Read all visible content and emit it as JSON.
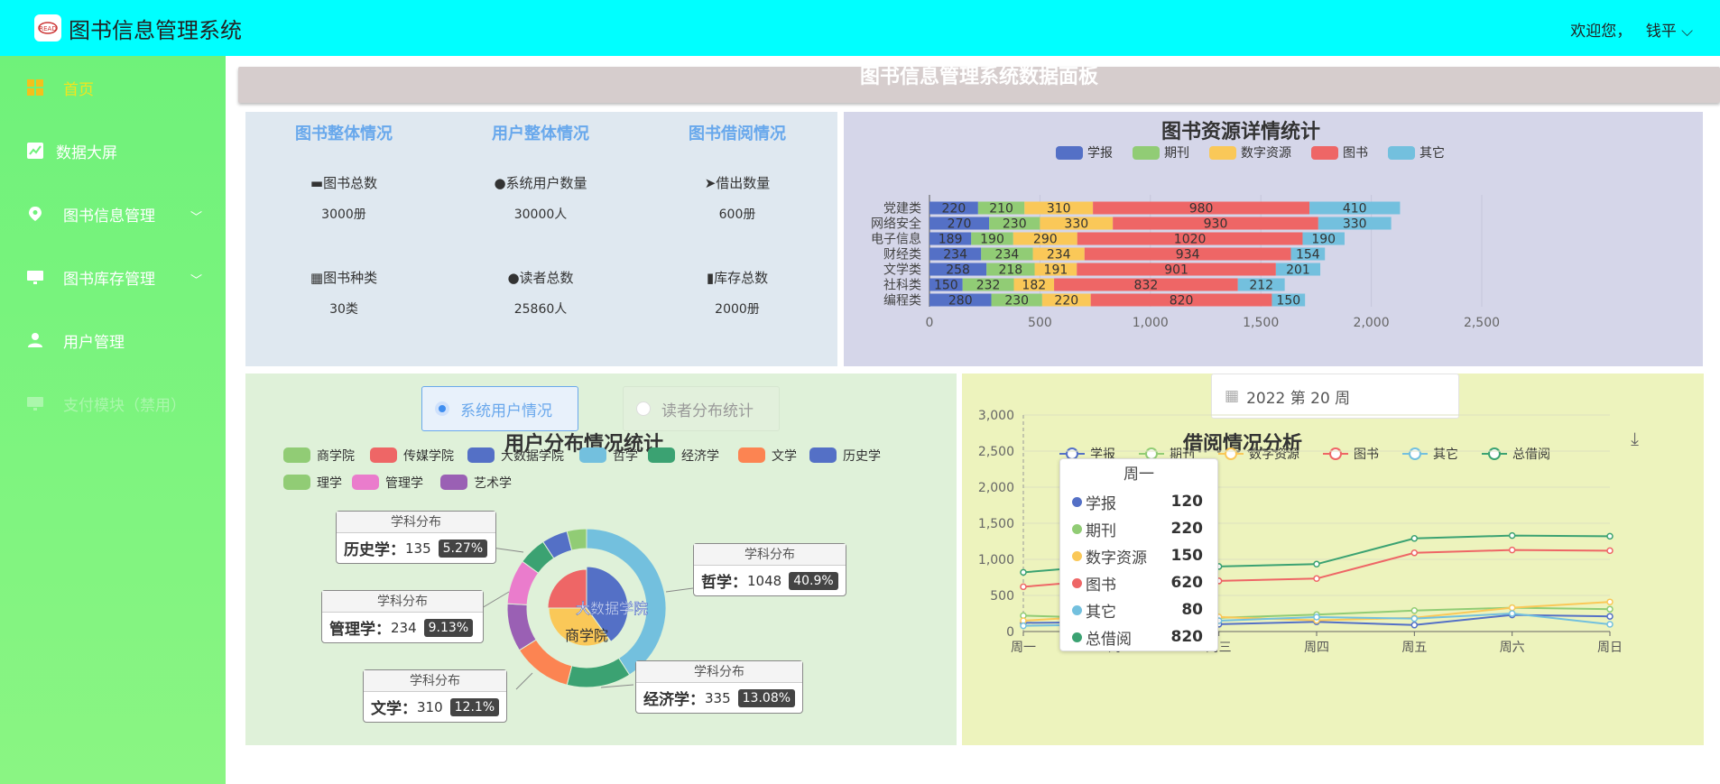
{
  "app": {
    "title": "图书信息管理系统",
    "greeting": "欢迎您，",
    "user": "钱平 ⌵"
  },
  "sidebar": {
    "items": [
      {
        "label": "首页",
        "icon": "grid-icon"
      },
      {
        "label": "数据大屏",
        "icon": "chart-icon"
      },
      {
        "label": "图书信息管理",
        "icon": "location-icon"
      },
      {
        "label": "图书库存管理",
        "icon": "monitor-icon"
      },
      {
        "label": "用户管理",
        "icon": "user-icon"
      },
      {
        "label": "支付模块（禁用）",
        "icon": "monitor-icon"
      }
    ]
  },
  "banner": {
    "title": "图书信息管理系统数据面板"
  },
  "overview": {
    "columns": [
      {
        "head": "图书整体情况",
        "items": [
          {
            "label": "图书总数",
            "icon": "book-icon",
            "value": "3000册"
          },
          {
            "label": "图书种类",
            "icon": "category-icon",
            "value": "30类"
          }
        ]
      },
      {
        "head": "用户整体情况",
        "items": [
          {
            "label": "系统用户数量",
            "icon": "user-icon",
            "value": "30000人"
          },
          {
            "label": "读者总数",
            "icon": "user-icon",
            "value": "25860人"
          }
        ]
      },
      {
        "head": "图书借阅情况",
        "items": [
          {
            "label": "借出数量",
            "icon": "send-icon",
            "value": "600册"
          },
          {
            "label": "库存总数",
            "icon": "bars-icon",
            "value": "2000册"
          }
        ]
      }
    ]
  },
  "tabs": {
    "users": "系统用户情况",
    "readers": "读者分布统计"
  },
  "date_picker": {
    "value": "2022 第 20 周"
  },
  "colors": {
    "blue": "#5470c6",
    "green": "#91cc75",
    "yellow": "#fac858",
    "red": "#ee6666",
    "cyan": "#73c0de",
    "teal": "#3ba272",
    "orange": "#fc8452",
    "purple": "#9a60b4",
    "pink": "#ea7ccc"
  },
  "chart_data": [
    {
      "type": "bar",
      "stacked": true,
      "orientation": "horizontal",
      "title": "图书资源详情统计",
      "categories": [
        "党建类",
        "网络安全",
        "电子信息",
        "财经类",
        "文学类",
        "社科类",
        "编程类"
      ],
      "series": [
        {
          "name": "学报",
          "values": [
            220,
            270,
            189,
            234,
            258,
            150,
            280
          ]
        },
        {
          "name": "期刊",
          "values": [
            210,
            230,
            190,
            234,
            218,
            232,
            230
          ]
        },
        {
          "name": "数字资源",
          "values": [
            310,
            330,
            290,
            234,
            191,
            182,
            220
          ]
        },
        {
          "name": "图书",
          "values": [
            980,
            930,
            1020,
            934,
            901,
            832,
            820
          ]
        },
        {
          "name": "其它",
          "values": [
            410,
            330,
            190,
            154,
            201,
            212,
            150
          ]
        }
      ],
      "xticks": [
        "0",
        "500",
        "1,000",
        "1,500",
        "2,000",
        "2,500"
      ],
      "xlim": [
        0,
        2500
      ],
      "legend": "top"
    },
    {
      "type": "pie",
      "title": "用户分布情况统计",
      "legend": [
        "商学院",
        "传媒学院",
        "大数据学院",
        "哲学",
        "经济学",
        "文学",
        "历史学",
        "理学",
        "管理学",
        "艺术学"
      ],
      "inner": [
        {
          "name": "大数据学院",
          "value": 40
        },
        {
          "name": "商学院",
          "value": 35
        },
        {
          "name": "传媒学院",
          "value": 25
        }
      ],
      "outer": [
        {
          "name": "哲学",
          "value": 1048,
          "pct": "40.9%"
        },
        {
          "name": "经济学",
          "value": 335,
          "pct": "13.08%"
        },
        {
          "name": "文学",
          "value": 310,
          "pct": "12.1%"
        },
        {
          "name": "艺术学",
          "value": 251
        },
        {
          "name": "管理学",
          "value": 234,
          "pct": "9.13%"
        },
        {
          "name": "理学",
          "value": 147
        },
        {
          "name": "历史学",
          "value": 135,
          "pct": "5.27%"
        },
        {
          "name": "商学院",
          "value": 102
        }
      ],
      "callout_head": "学科分布"
    },
    {
      "type": "line",
      "title": "借阅情况分析",
      "categories": [
        "周一",
        "周二",
        "周三",
        "周四",
        "周五",
        "周六",
        "周日"
      ],
      "series": [
        {
          "name": "学报",
          "values": [
            120,
            132,
            101,
            134,
            90,
            230,
            210
          ]
        },
        {
          "name": "期刊",
          "values": [
            220,
            182,
            191,
            234,
            290,
            330,
            310
          ]
        },
        {
          "name": "数字资源",
          "values": [
            150,
            232,
            201,
            154,
            190,
            330,
            410
          ]
        },
        {
          "name": "图书",
          "values": [
            620,
            732,
            701,
            734,
            1090,
            1130,
            1120
          ]
        },
        {
          "name": "其它",
          "values": [
            80,
            100,
            150,
            200,
            180,
            250,
            100
          ]
        },
        {
          "name": "总借阅",
          "values": [
            820,
            932,
            901,
            934,
            1290,
            1330,
            1320
          ]
        }
      ],
      "yticks": [
        "0",
        "500",
        "1,000",
        "1,500",
        "2,000",
        "2,500",
        "3,000"
      ],
      "ylim": [
        0,
        3000
      ],
      "tooltip": {
        "title": "周一",
        "rows": [
          [
            "学报",
            "120"
          ],
          [
            "期刊",
            "220"
          ],
          [
            "数字资源",
            "150"
          ],
          [
            "图书",
            "620"
          ],
          [
            "其它",
            "80"
          ],
          [
            "总借阅",
            "820"
          ]
        ]
      }
    }
  ]
}
